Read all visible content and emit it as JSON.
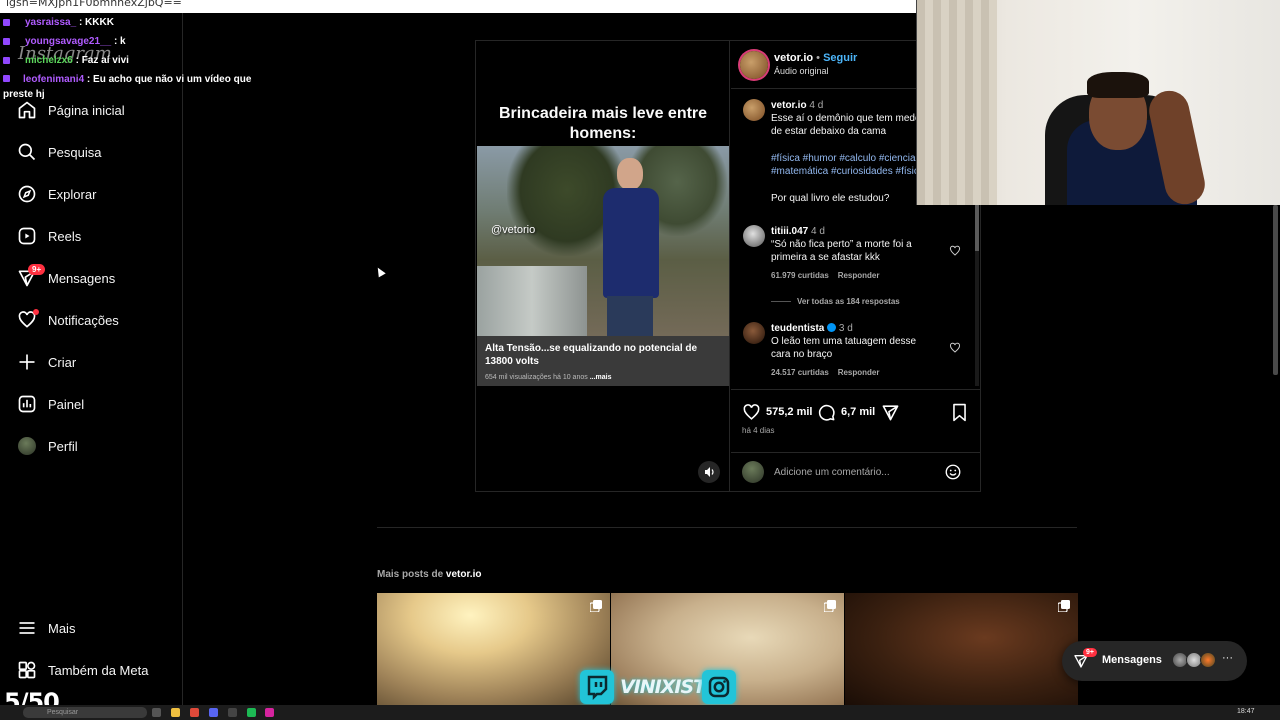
{
  "browser": {
    "url_fragment": "igsh=MXJpn1F0bmhnexZjbQ=="
  },
  "sidebar": {
    "logo": "Instagram",
    "items": [
      {
        "label": "Página inicial",
        "icon": "home-icon"
      },
      {
        "label": "Pesquisa",
        "icon": "search-icon"
      },
      {
        "label": "Explorar",
        "icon": "compass-icon"
      },
      {
        "label": "Reels",
        "icon": "reels-icon"
      },
      {
        "label": "Mensagens",
        "icon": "messenger-icon",
        "badge": "9+"
      },
      {
        "label": "Notificações",
        "icon": "heart-icon"
      },
      {
        "label": "Criar",
        "icon": "plus-icon"
      },
      {
        "label": "Painel",
        "icon": "dashboard-icon"
      },
      {
        "label": "Perfil",
        "icon": "avatar"
      }
    ],
    "bottom": [
      {
        "label": "Mais",
        "icon": "menu-icon"
      },
      {
        "label": "Também da Meta",
        "icon": "meta-icon"
      }
    ]
  },
  "chat": [
    {
      "user": "yasraissa_",
      "msg": ": KKKK"
    },
    {
      "user": "youngsavage21__",
      "msg": ": k"
    },
    {
      "user": "michelzx6",
      "msg": ": Faz aí vivi"
    },
    {
      "user": "leofenimani4",
      "msg": ": Eu acho que não vi um vídeo que preste hj"
    }
  ],
  "post": {
    "media": {
      "title": "Brincadeira mais leve entre homens:",
      "watermark": "@vetorio",
      "video_caption": "Alta Tensão...se equalizando no potencial de 13800 volts",
      "video_meta": "654 mil visualizações  há 10 anos",
      "video_more": "...mais"
    },
    "author": {
      "name": "vetor.io",
      "sep": " • ",
      "follow": "Seguir",
      "audio": "Áudio original"
    },
    "caption": {
      "user": "vetor.io",
      "time": "4 d",
      "text": "Esse aí o demônio que tem medo de estar debaixo da cama",
      "tags": "#física #humor #calculo #ciencia #matemática #curiosidades #física",
      "question": "Por qual livro ele estudou?"
    },
    "comments": [
      {
        "user": "titiii.047",
        "time": "4 d",
        "text": "“Só não fica perto” a morte foi a primeira a se afastar kkk",
        "likes": "61.979 curtidas",
        "reply": "Responder"
      },
      {
        "user": "teudentista",
        "time": "3 d",
        "verified": true,
        "text": "O leão tem uma tatuagem desse cara no braço",
        "likes": "24.517 curtidas",
        "reply": "Responder"
      }
    ],
    "view_replies": "Ver todas as 184 respostas",
    "likes": "575,2 mil",
    "comment_count": "6,7 mil",
    "posted": "há 4 dias",
    "add_comment_placeholder": "Adicione um comentário..."
  },
  "more_posts": {
    "prefix": "Mais posts de ",
    "user": "vetor.io"
  },
  "messages_pill": {
    "label": "Mensagens",
    "badge": "9+"
  },
  "counter": "5/50",
  "banner": {
    "name": "VINIXISTE"
  },
  "taskbar": {
    "search": "Pesquisar",
    "time": "18:47"
  },
  "colors": {
    "accent": "#4cb5f9",
    "badge": "#ff3040",
    "chat_user": "#b05cff",
    "banner": "#22c4d8"
  }
}
